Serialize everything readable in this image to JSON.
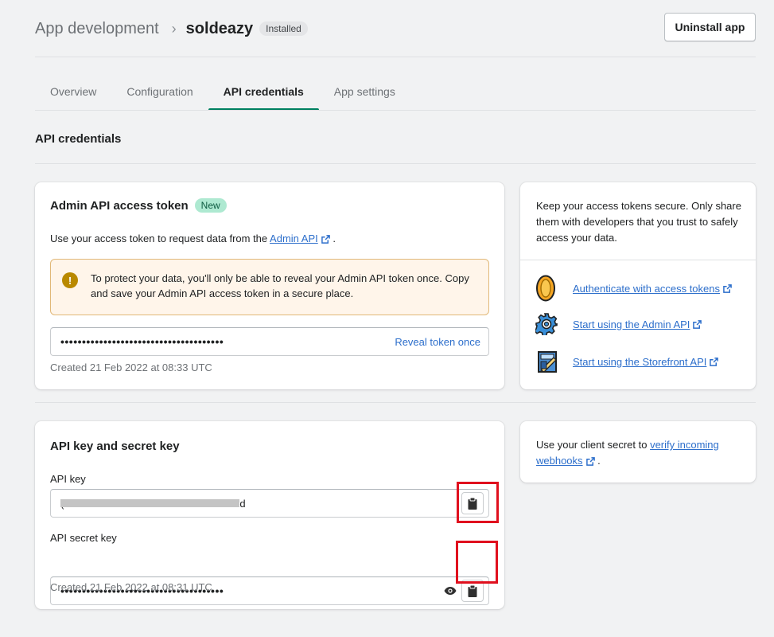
{
  "header": {
    "breadcrumb_parent": "App development",
    "breadcrumb_separator": "›",
    "app_name": "soldeazy",
    "status_badge": "Installed",
    "uninstall_label": "Uninstall app"
  },
  "tabs": [
    {
      "label": "Overview",
      "active": false
    },
    {
      "label": "Configuration",
      "active": false
    },
    {
      "label": "API credentials",
      "active": true
    },
    {
      "label": "App settings",
      "active": false
    }
  ],
  "section_title": "API credentials",
  "admin_token_card": {
    "title": "Admin API access token",
    "new_badge": "New",
    "description_prefix": "Use your access token to request data from the ",
    "description_link": "Admin API",
    "description_suffix": " .",
    "banner_text": "To protect your data, you'll only be able to reveal your Admin API token once. Copy and save your Admin API access token in a secure place.",
    "token_masked": "••••••••••••••••••••••••••••••••••••••",
    "reveal_label": "Reveal token once",
    "created_text": "Created 21 Feb 2022 at 08:33 UTC"
  },
  "side_card_tokens": {
    "text": "Keep your access tokens secure. Only share them with developers that you trust to safely access your data.",
    "links": [
      {
        "label": "Authenticate with access tokens",
        "icon": "coin-icon"
      },
      {
        "label": "Start using the Admin API",
        "icon": "gear-icon"
      },
      {
        "label": "Start using the Storefront API",
        "icon": "storefront-icon"
      }
    ]
  },
  "keys_card": {
    "title": "API key and secret key",
    "api_key_label": "API key",
    "api_key_value_tail": "d",
    "api_key_value_head": "(",
    "secret_label": "API secret key",
    "secret_masked": "••••••••••••••••••••••••••••••••••••••",
    "created_text": "Created 21 Feb 2022 at 08:31 UTC"
  },
  "side_card_webhooks": {
    "text_prefix": "Use your client secret to ",
    "link_part1": "verify incoming",
    "link_part2": "webhooks",
    "text_suffix": " ."
  },
  "colors": {
    "accent": "#008060",
    "link": "#2c6ecb",
    "highlight": "#e0101e",
    "warning_bg": "#fff5ea"
  }
}
